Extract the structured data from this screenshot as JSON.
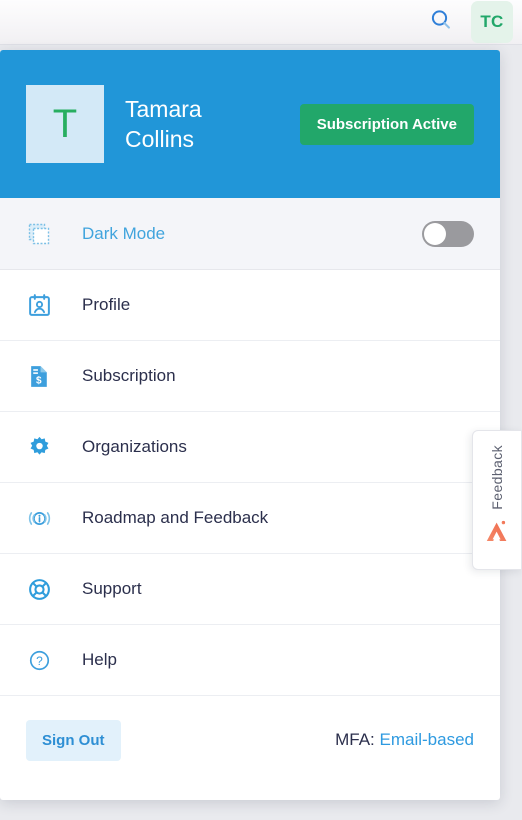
{
  "topbar": {
    "search_icon": "search-icon",
    "avatar_initials": "TC"
  },
  "profile": {
    "initial": "T",
    "name": "Tamara Collins",
    "subscription_badge": "Subscription Active"
  },
  "dark_mode": {
    "label": "Dark Mode",
    "icon": "broken-image-icon",
    "toggle_state": "off"
  },
  "menu": {
    "items": [
      {
        "label": "Profile",
        "icon": "id-badge-icon"
      },
      {
        "label": "Subscription",
        "icon": "invoice-dollar-icon"
      },
      {
        "label": "Organizations",
        "icon": "gear-icon"
      },
      {
        "label": "Roadmap and Feedback",
        "icon": "announcement-info-icon"
      },
      {
        "label": "Support",
        "icon": "lifebuoy-icon"
      },
      {
        "label": "Help",
        "icon": "question-circle-icon"
      }
    ]
  },
  "footer": {
    "sign_out": "Sign Out",
    "mfa_label": "MFA:",
    "mfa_value": "Email-based"
  },
  "feedback_tab": {
    "label": "Feedback",
    "logo": "marker-logo-icon"
  },
  "colors": {
    "brand_blue": "#2196d8",
    "accent_green": "#22a76a",
    "link_blue": "#2e9ae0",
    "text_dark": "#2b2f4c",
    "toggle_off": "#9a9a9e",
    "feedback_orange": "#f2714f"
  }
}
